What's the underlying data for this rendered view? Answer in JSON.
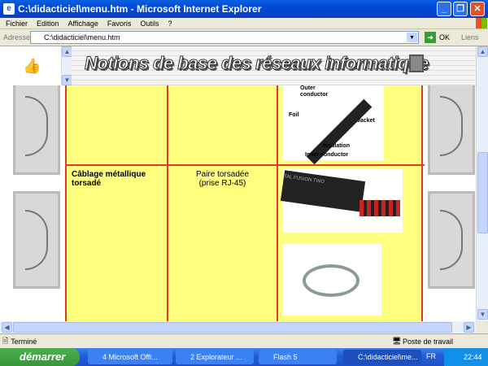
{
  "window": {
    "title": "C:\\didacticiel\\menu.htm - Microsoft Internet Explorer"
  },
  "menu": [
    "Fichier",
    "Edition",
    "Affichage",
    "Favoris",
    "Outils",
    "?"
  ],
  "address": {
    "label": "Adresse",
    "value": "C:\\didacticiel\\menu.htm",
    "go": "OK",
    "links": "Liens"
  },
  "banner": {
    "title": "Notions de base des réseaux informatique"
  },
  "table": {
    "row2": {
      "category": "Câblage métallique torsadé",
      "type_line1": "Paire torsadée",
      "type_line2": "(prise RJ-45)"
    },
    "coax_labels": [
      "Outer conductor",
      "Foil",
      "Jacket",
      "Insulation",
      "Inner conductor"
    ],
    "cable_brand": "TAL FUSION TWO"
  },
  "status": {
    "text": "Terminé",
    "zone": "Poste de travail"
  },
  "taskbar": {
    "start": "démarrer",
    "tasks": [
      "4 Microsoft Offi...",
      "2 Explorateur ...",
      "Flash 5",
      "C:\\didacticiel\\me..."
    ],
    "lang": "FR",
    "clock": "22:44"
  }
}
